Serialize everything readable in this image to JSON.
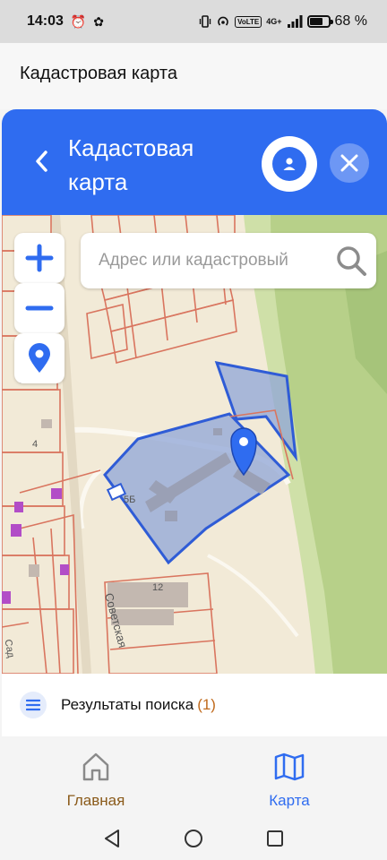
{
  "status_bar": {
    "time": "14:03",
    "left_icons": "⏰ ✿",
    "network": "4G+",
    "volte": "VoLTE",
    "battery_percent": "68 %",
    "battery_level": 0.68
  },
  "page_header": {
    "title": "Кадастровая карта"
  },
  "card_header": {
    "title": "Кадастовая карта",
    "back_icon": "chevron-left-icon",
    "profile_icon": "user-icon",
    "close_icon": "close-icon"
  },
  "map": {
    "search_placeholder": "Адрес или кадастровый",
    "zoom_in_icon": "plus-icon",
    "zoom_out_icon": "minus-icon",
    "locate_icon": "location-pin-icon",
    "labels": {
      "street": "Советская",
      "house_4": "4",
      "house_5b": "5Б",
      "house_5a": "5а",
      "house_12": "12",
      "street_fragment": "Сад"
    },
    "parcel_fill": "#8fa6d8",
    "parcel_stroke": "#2f5cd6",
    "boundary_color": "#d86a55"
  },
  "results": {
    "label": "Результаты поиска",
    "count": "(1)",
    "icon": "list-icon"
  },
  "bottom_nav": {
    "items": [
      {
        "label": "Главная",
        "icon": "home-icon",
        "color": "#8a5a1a"
      },
      {
        "label": "Карта",
        "icon": "map-icon",
        "color": "#2f6cf0"
      }
    ],
    "active_index": 1
  },
  "system_nav": {
    "back": "back-triangle-icon",
    "home": "home-circle-icon",
    "recents": "recents-square-icon"
  }
}
